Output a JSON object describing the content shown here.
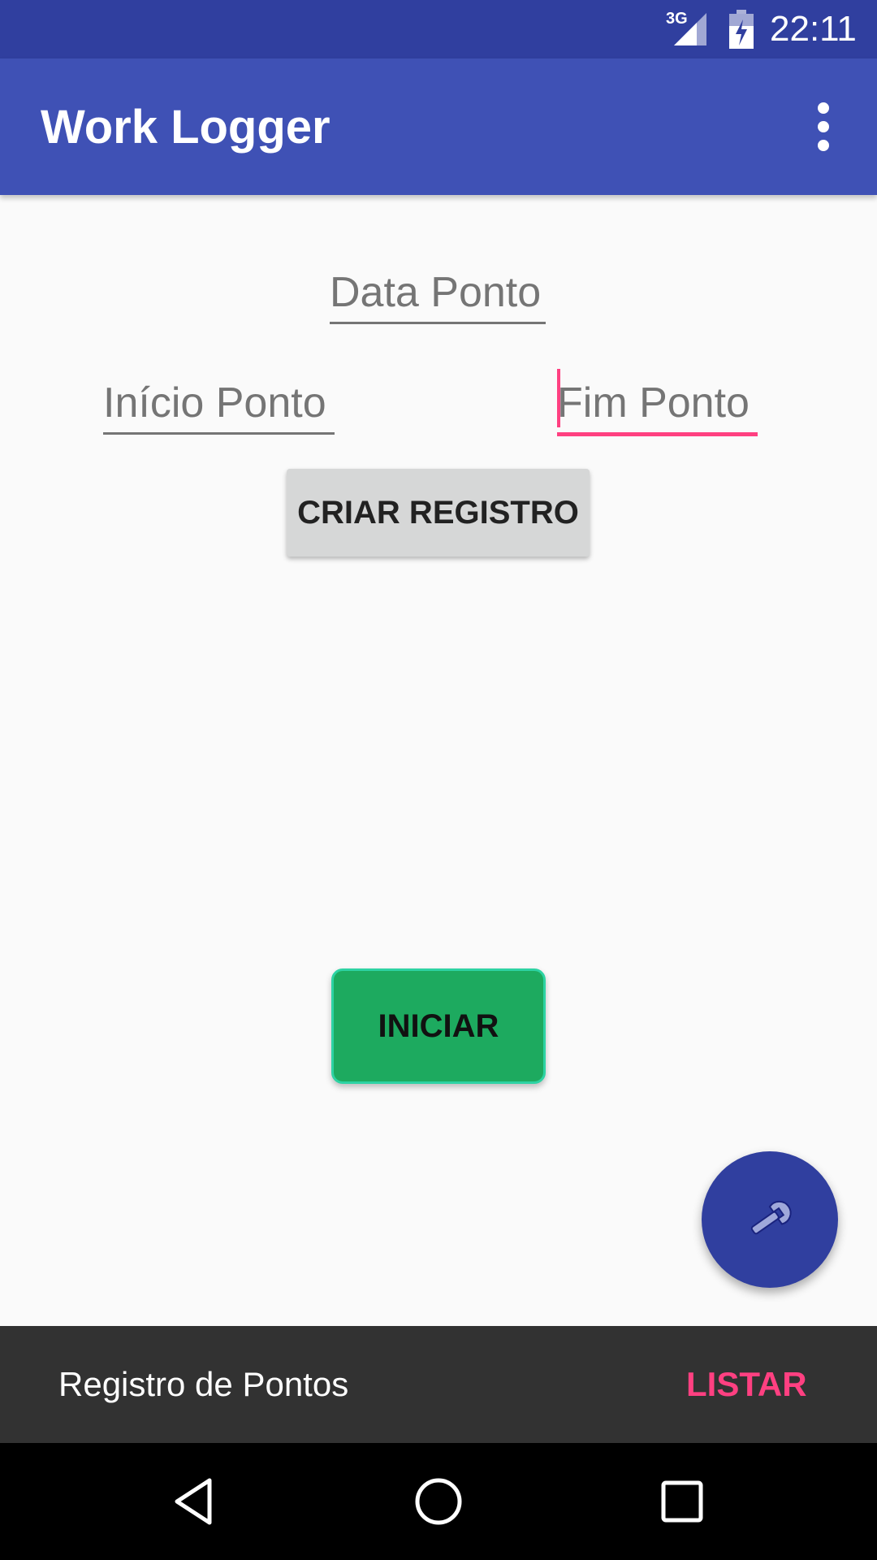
{
  "status_bar": {
    "network": "3G",
    "time": "22:11"
  },
  "app_bar": {
    "title": "Work Logger"
  },
  "form": {
    "data_ponto_placeholder": "Data Ponto",
    "inicio_ponto_placeholder": "Início Ponto",
    "fim_ponto_placeholder": "Fim Ponto",
    "criar_registro_label": "CRIAR REGISTRO"
  },
  "iniciar_label": "INICIAR",
  "fab": {
    "icon": "wrench-icon"
  },
  "snackbar": {
    "message": "Registro de Pontos",
    "action": "LISTAR"
  },
  "nav_bar": {
    "icons": [
      "back-icon",
      "home-icon",
      "recents-icon"
    ]
  },
  "colors": {
    "primary": "#3f51b5",
    "primary_dark": "#303f9f",
    "accent": "#ff4081",
    "iniciar_green": "#1daa5f"
  }
}
